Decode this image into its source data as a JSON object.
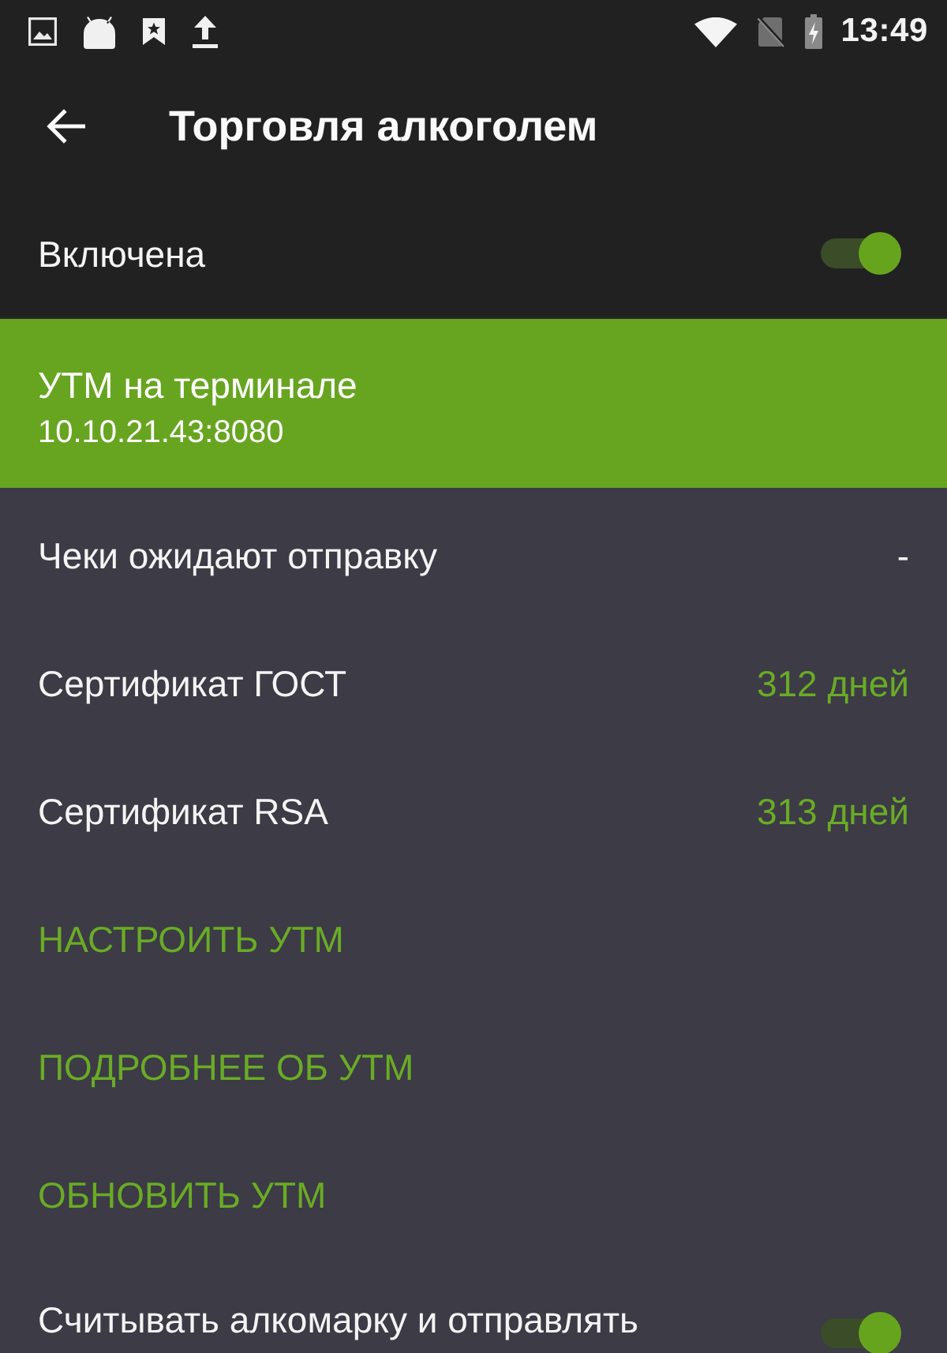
{
  "status_bar": {
    "time": "13:49"
  },
  "toolbar": {
    "title": "Торговля алкоголем"
  },
  "master_switch": {
    "label": "Включена",
    "on": true
  },
  "utm": {
    "title": "УТМ на терминале",
    "address": "10.10.21.43:8080"
  },
  "info_rows": [
    {
      "label": "Чеки ожидают отправку",
      "value": "-",
      "kind": "plain"
    },
    {
      "label": "Сертификат ГОСТ",
      "value": "312 дней",
      "kind": "valid"
    },
    {
      "label": "Сертификат RSA",
      "value": "313 дней",
      "kind": "valid"
    }
  ],
  "actions": [
    {
      "label": "НАСТРОИТЬ УТМ"
    },
    {
      "label": "ПОДРОБНЕЕ ОБ УТМ"
    },
    {
      "label": "ОБНОВИТЬ УТМ"
    }
  ],
  "settings": [
    {
      "label": "Считывать алкомарку и отправлять",
      "on": true
    }
  ]
}
